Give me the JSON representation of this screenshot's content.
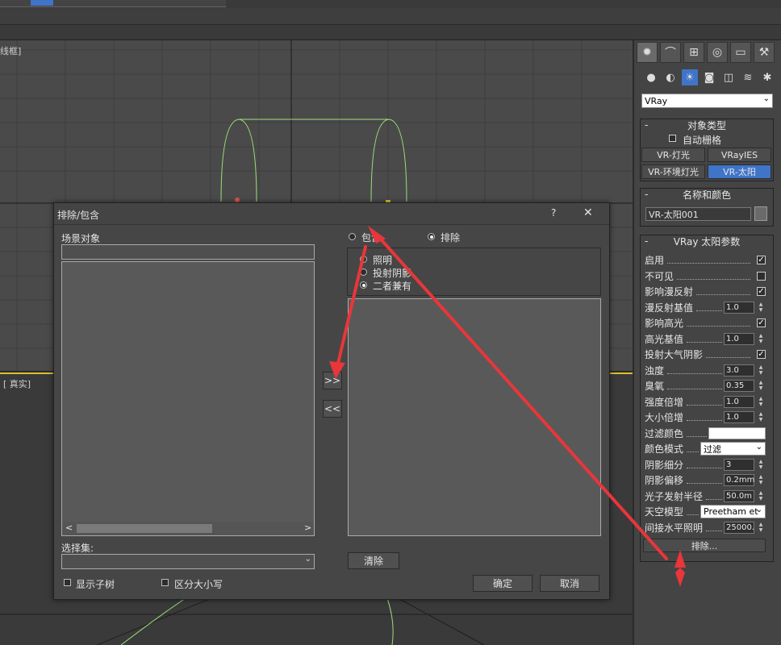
{
  "viewports": {
    "top_label": "线框]",
    "bottom_label": "[ 真实]"
  },
  "command_panel": {
    "tabs": [
      {
        "name": "create",
        "glyph": "✹"
      },
      {
        "name": "modify",
        "glyph": "⌒"
      },
      {
        "name": "hierarchy",
        "glyph": "⊞"
      },
      {
        "name": "motion",
        "glyph": "◎"
      },
      {
        "name": "display",
        "glyph": "▭"
      },
      {
        "name": "utilities",
        "glyph": "⚒"
      }
    ],
    "sub_icons": [
      {
        "name": "geometry",
        "glyph": "●"
      },
      {
        "name": "shapes",
        "glyph": "◐"
      },
      {
        "name": "lights",
        "glyph": "☀"
      },
      {
        "name": "cameras",
        "glyph": "◙"
      },
      {
        "name": "helpers",
        "glyph": "◫"
      },
      {
        "name": "spacewarps",
        "glyph": "≋"
      },
      {
        "name": "systems",
        "glyph": "✱"
      }
    ],
    "renderer_dropdown": "VRay",
    "object_type": {
      "title": "对象类型",
      "autogrid": "自动栅格",
      "buttons": [
        "VR-灯光",
        "VRayIES",
        "VR-环境灯光",
        "VR-太阳"
      ],
      "selected": "VR-太阳"
    },
    "name_color": {
      "title": "名称和颜色",
      "name_value": "VR-太阳001"
    },
    "sun_params": {
      "title": "VRay 太阳参数",
      "rows": [
        {
          "label": "启用",
          "type": "check",
          "value": "✓"
        },
        {
          "label": "不可见",
          "type": "check",
          "value": ""
        },
        {
          "label": "影响漫反射",
          "type": "check",
          "value": "✓"
        },
        {
          "label": "漫反射基值",
          "type": "spin",
          "value": "1.0"
        },
        {
          "label": "影响高光",
          "type": "check",
          "value": "✓"
        },
        {
          "label": "高光基值",
          "type": "spin",
          "value": "1.0"
        },
        {
          "label": "投射大气阴影",
          "type": "check",
          "value": "✓"
        },
        {
          "label": "浊度",
          "type": "spin",
          "value": "3.0"
        },
        {
          "label": "臭氧",
          "type": "spin",
          "value": "0.35"
        },
        {
          "label": "强度倍增",
          "type": "spin",
          "value": "1.0"
        },
        {
          "label": "大小倍增",
          "type": "spin",
          "value": "1.0"
        },
        {
          "label": "过滤颜色",
          "type": "color",
          "value": "#ffffff"
        },
        {
          "label": "颜色模式",
          "type": "combo",
          "value": "过滤"
        },
        {
          "label": "阴影细分",
          "type": "spin",
          "value": "3"
        },
        {
          "label": "阴影偏移",
          "type": "spin",
          "value": "0.2mm"
        },
        {
          "label": "光子发射半径",
          "type": "spin",
          "value": "50.0m"
        },
        {
          "label": "天空模型",
          "type": "combo",
          "value": "Preetham et"
        },
        {
          "label": "间接水平照明",
          "type": "spin",
          "value": "25000."
        }
      ],
      "exclude_button": "排除..."
    }
  },
  "dialog": {
    "title": "排除/包含",
    "help": "?",
    "close": "✕",
    "scene_objects_label": "场景对象",
    "scene_search_value": "",
    "include_label": "包含",
    "exclude_label": "排除",
    "mode_selected": "exclude",
    "options": [
      "照明",
      "投射阴影",
      "二者兼有"
    ],
    "option_selected": "二者兼有",
    "add_button": ">>",
    "remove_button": "<<",
    "selection_set_label": "选择集:",
    "selection_set_value": "",
    "clear_button": "清除",
    "show_subtree": "显示子树",
    "case_sensitive": "区分大小写",
    "ok_button": "确定",
    "cancel_button": "取消"
  },
  "annotation_color": "#e8363a"
}
